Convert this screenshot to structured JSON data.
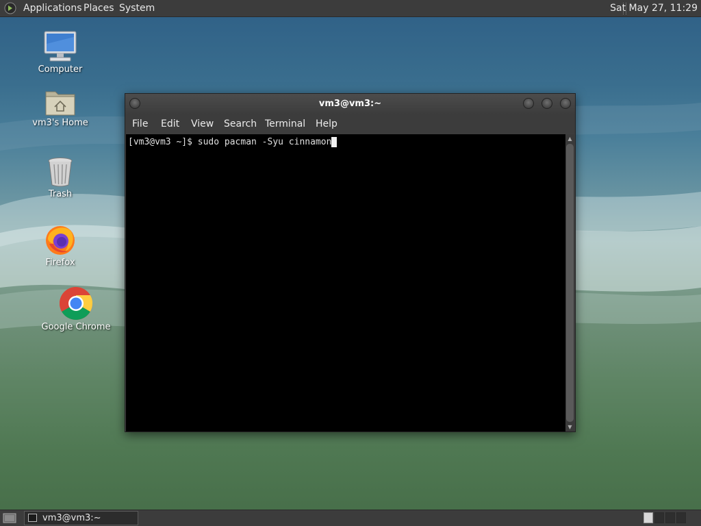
{
  "top_panel": {
    "menus": [
      "Applications",
      "Places",
      "System"
    ],
    "clock": "Sat May 27, 11:29"
  },
  "desktop": {
    "icons": [
      {
        "label": "Computer",
        "icon": "computer-icon"
      },
      {
        "label": "vm3's Home",
        "icon": "home-folder-icon"
      },
      {
        "label": "Trash",
        "icon": "trash-icon"
      },
      {
        "label": "Firefox",
        "icon": "firefox-icon"
      },
      {
        "label": "Google Chrome",
        "icon": "chrome-icon"
      }
    ]
  },
  "terminal": {
    "title": "vm3@vm3:~",
    "menu": [
      "File",
      "Edit",
      "View",
      "Search",
      "Terminal",
      "Help"
    ],
    "prompt": "[vm3@vm3 ~]$ ",
    "command": "sudo pacman -Syu cinnamon"
  },
  "bottom_panel": {
    "task_label": "vm3@vm3:~",
    "workspaces": 4,
    "active_workspace": 1
  },
  "colors": {
    "panel": "#3c3c3c",
    "terminal_bg": "#000000",
    "terminal_fg": "#e0e0e0"
  }
}
